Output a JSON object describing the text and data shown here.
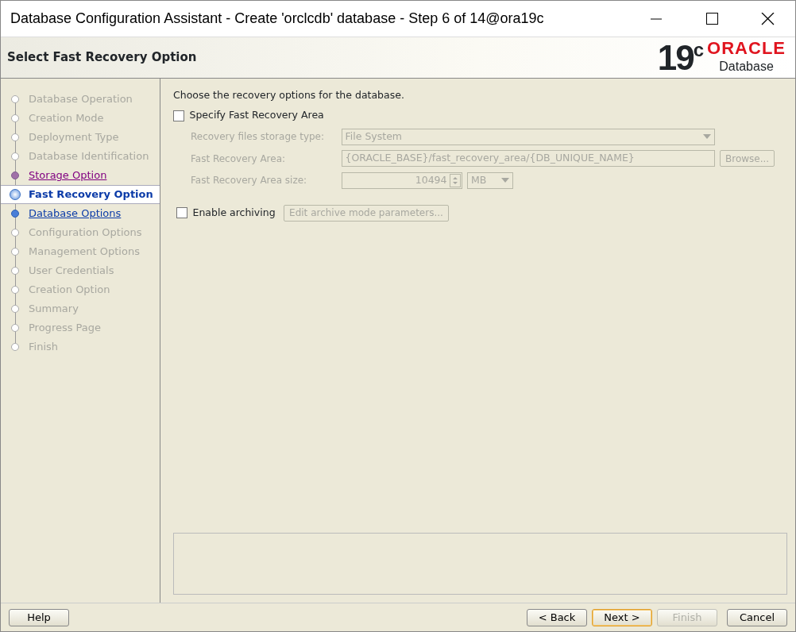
{
  "window": {
    "title": "Database Configuration Assistant - Create 'orclcdb' database - Step 6 of 14@ora19c"
  },
  "header": {
    "title": "Select Fast Recovery Option",
    "logo": {
      "version": "19$^{c}$",
      "brand": "ORACLE",
      "product": "Database"
    }
  },
  "steps": [
    {
      "label": "Database Operation",
      "kind": "inactive",
      "selected": false
    },
    {
      "label": "Creation Mode",
      "kind": "inactive",
      "selected": false
    },
    {
      "label": "Deployment Type",
      "kind": "inactive",
      "selected": false
    },
    {
      "label": "Database Identification",
      "kind": "inactive",
      "selected": false
    },
    {
      "label": "Storage Option",
      "kind": "visited",
      "selected": false
    },
    {
      "label": "Fast Recovery Option",
      "kind": "link",
      "selected": true
    },
    {
      "label": "Database Options",
      "kind": "link",
      "selected": false
    },
    {
      "label": "Configuration Options",
      "kind": "inactive",
      "selected": false
    },
    {
      "label": "Management Options",
      "kind": "inactive",
      "selected": false
    },
    {
      "label": "User Credentials",
      "kind": "inactive",
      "selected": false
    },
    {
      "label": "Creation Option",
      "kind": "inactive",
      "selected": false
    },
    {
      "label": "Summary",
      "kind": "inactive",
      "selected": false
    },
    {
      "label": "Progress Page",
      "kind": "inactive",
      "selected": false
    },
    {
      "label": "Finish",
      "kind": "inactive",
      "selected": false
    }
  ],
  "content": {
    "intro": "Choose the recovery options for the database.",
    "specify_fra": {
      "label": "Specify Fast Recovery Area",
      "checked": false
    },
    "storage_type": {
      "label": "Recovery files storage type:",
      "value": "File System",
      "disabled": true
    },
    "fra_location": {
      "label": "Fast Recovery Area:",
      "value": "{ORACLE_BASE}/fast_recovery_area/{DB_UNIQUE_NAME}",
      "disabled": true,
      "button": "Browse..."
    },
    "fra_size": {
      "label": "Fast Recovery Area size:",
      "value": "10494",
      "unit": "MB",
      "disabled": true
    },
    "archiving": {
      "label": "Enable archiving",
      "checked": false,
      "button": "Edit archive mode parameters...",
      "button_disabled": true
    }
  },
  "buttons": [
    {
      "label": "Help",
      "disabled": false,
      "default": false
    },
    {
      "label": "< Back",
      "disabled": false,
      "default": false
    },
    {
      "label": "Next >",
      "disabled": false,
      "default": true
    },
    {
      "label": "Finish",
      "disabled": true,
      "default": false
    },
    {
      "label": "Cancel",
      "disabled": false,
      "default": false
    }
  ]
}
